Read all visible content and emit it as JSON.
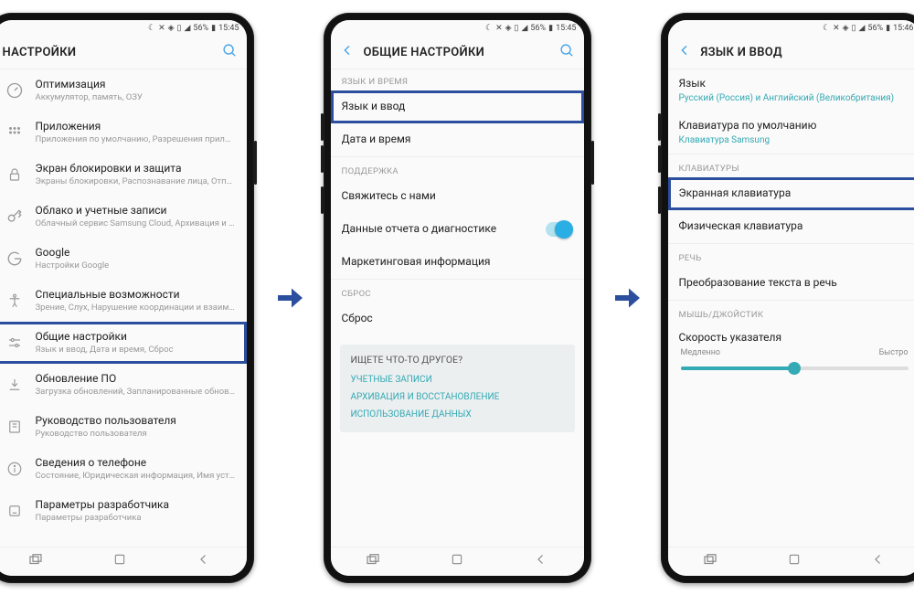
{
  "status": {
    "pct": "56%",
    "t1": "15:45",
    "t2": "15:45",
    "t3": "15:46"
  },
  "p1": {
    "header": "НАСТРОЙКИ",
    "items": [
      {
        "name": "optimization-item",
        "icon": "gauge",
        "label": "Оптимизация",
        "sub": "Аккумулятор, память, ОЗУ"
      },
      {
        "name": "apps-item",
        "icon": "grid",
        "label": "Приложения",
        "sub": "Приложения по умолчанию, Разрешения прило..."
      },
      {
        "name": "lockscreen-item",
        "icon": "lock",
        "label": "Экран блокировки и защита",
        "sub": "Экраны блокировки, Распознавание лица, Отпеча..."
      },
      {
        "name": "cloud-item",
        "icon": "key",
        "label": "Облако и учетные записи",
        "sub": "Облачный сервис Samsung Cloud, Архивация и в..."
      },
      {
        "name": "google-item",
        "icon": "google",
        "label": "Google",
        "sub": "Настройки Google"
      },
      {
        "name": "accessibility-item",
        "icon": "accessibility",
        "label": "Специальные возможности",
        "sub": "Зрение, Слух, Нарушение координации и взаимо..."
      },
      {
        "name": "general-item",
        "icon": "sliders",
        "label": "Общие настройки",
        "sub": "Язык и ввод, Дата и время, Сброс",
        "hl": true
      },
      {
        "name": "update-item",
        "icon": "download",
        "label": "Обновление ПО",
        "sub": "Загрузка обновлений, Запланированные обновле..."
      },
      {
        "name": "manual-item",
        "icon": "guide",
        "label": "Руководство пользователя",
        "sub": "Руководство пользователя"
      },
      {
        "name": "about-item",
        "icon": "info",
        "label": "Сведения о телефоне",
        "sub": "Состояние, Юридическая информация, Имя устр..."
      },
      {
        "name": "devopts-item",
        "icon": "dev",
        "label": "Параметры разработчика",
        "sub": "Параметры разработчика"
      }
    ]
  },
  "p2": {
    "header": "ОБЩИЕ НАСТРОЙКИ",
    "s1": {
      "title": "ЯЗЫК И ВРЕМЯ",
      "i1": {
        "label": "Язык и ввод",
        "hl": true
      },
      "i2": {
        "label": "Дата и время"
      }
    },
    "s2": {
      "title": "ПОДДЕРЖКА",
      "i1": {
        "label": "Свяжитесь с нами"
      },
      "i2": {
        "label": "Данные отчета о диагностике"
      },
      "i3": {
        "label": "Маркетинговая информация"
      }
    },
    "s3": {
      "title": "СБРОС",
      "i1": {
        "label": "Сброс"
      }
    },
    "lf": {
      "title": "ИЩЕТЕ ЧТО-ТО ДРУГОЕ?",
      "l1": "УЧЕТНЫЕ ЗАПИСИ",
      "l2": "АРХИВАЦИЯ И ВОССТАНОВЛЕНИЕ",
      "l3": "ИСПОЛЬЗОВАНИЕ ДАННЫХ"
    }
  },
  "p3": {
    "header": "ЯЗЫК И ВВОД",
    "i1": {
      "label": "Язык",
      "sub": "Русский (Россия) и Английский (Великобритания)"
    },
    "i2": {
      "label": "Клавиатура по умолчанию",
      "sub": "Клавиатура Samsung"
    },
    "s1": {
      "title": "КЛАВИАТУРЫ",
      "i1": {
        "label": "Экранная клавиатура",
        "hl": true
      },
      "i2": {
        "label": "Физическая клавиатура"
      }
    },
    "s2": {
      "title": "РЕЧЬ",
      "i1": {
        "label": "Преобразование текста в речь"
      }
    },
    "s3": {
      "title": "МЫШЬ/ДЖОЙСТИК",
      "i1": {
        "label": "Скорость указателя"
      },
      "slow": "Медленно",
      "fast": "Быстро"
    }
  }
}
